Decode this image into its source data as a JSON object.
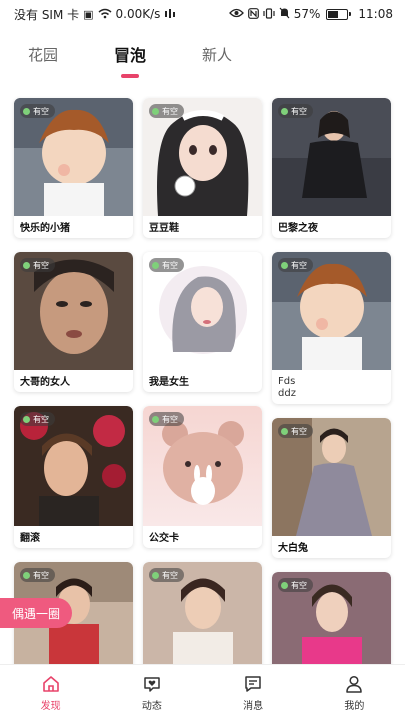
{
  "status_bar": {
    "carrier": "没有 SIM 卡",
    "speed": "0.00K/s",
    "battery": "57%",
    "battery_level": 0.57,
    "time": "11:08"
  },
  "tabs": [
    {
      "label": "花园",
      "active": false
    },
    {
      "label": "冒泡",
      "active": true
    },
    {
      "label": "新人",
      "active": false
    }
  ],
  "badge_label": "有空",
  "cards": [
    {
      "title": "快乐的小猪",
      "image": "anime-boy-yawn-photo"
    },
    {
      "title": "豆豆鞋",
      "image": "girl-twin-tails-photo"
    },
    {
      "title": "巴黎之夜",
      "image": "woman-black-dress-photo"
    },
    {
      "title": "大哥的女人",
      "image": "woman-close-up-film-photo"
    },
    {
      "title": "我是女生",
      "image": "girl-illustration-circle-photo"
    },
    {
      "title": "Fds\nddz",
      "image": "anime-boy-yawn-photo"
    },
    {
      "title": "翻滚",
      "image": "woman-roses-photo"
    },
    {
      "title": "公交卡",
      "image": "bear-bunny-photo"
    },
    {
      "title": "大白兔",
      "image": "woman-gown-photo"
    },
    {
      "title": "",
      "image": "woman-red-dress-photo"
    },
    {
      "title": "",
      "image": "woman-white-top-photo"
    },
    {
      "title": "",
      "image": "woman-pink-outfit-photo"
    }
  ],
  "float_button": "偶遇一圈",
  "bottom_nav": [
    {
      "label": "发现",
      "icon": "home-icon",
      "active": true
    },
    {
      "label": "动态",
      "icon": "heart-chat-icon",
      "active": false
    },
    {
      "label": "消息",
      "icon": "message-icon",
      "active": false
    },
    {
      "label": "我的",
      "icon": "person-icon",
      "active": false
    }
  ],
  "colors": {
    "accent": "#e8436a",
    "float_pill": "#ef5a7f",
    "badge_dot": "#7fd07a"
  }
}
